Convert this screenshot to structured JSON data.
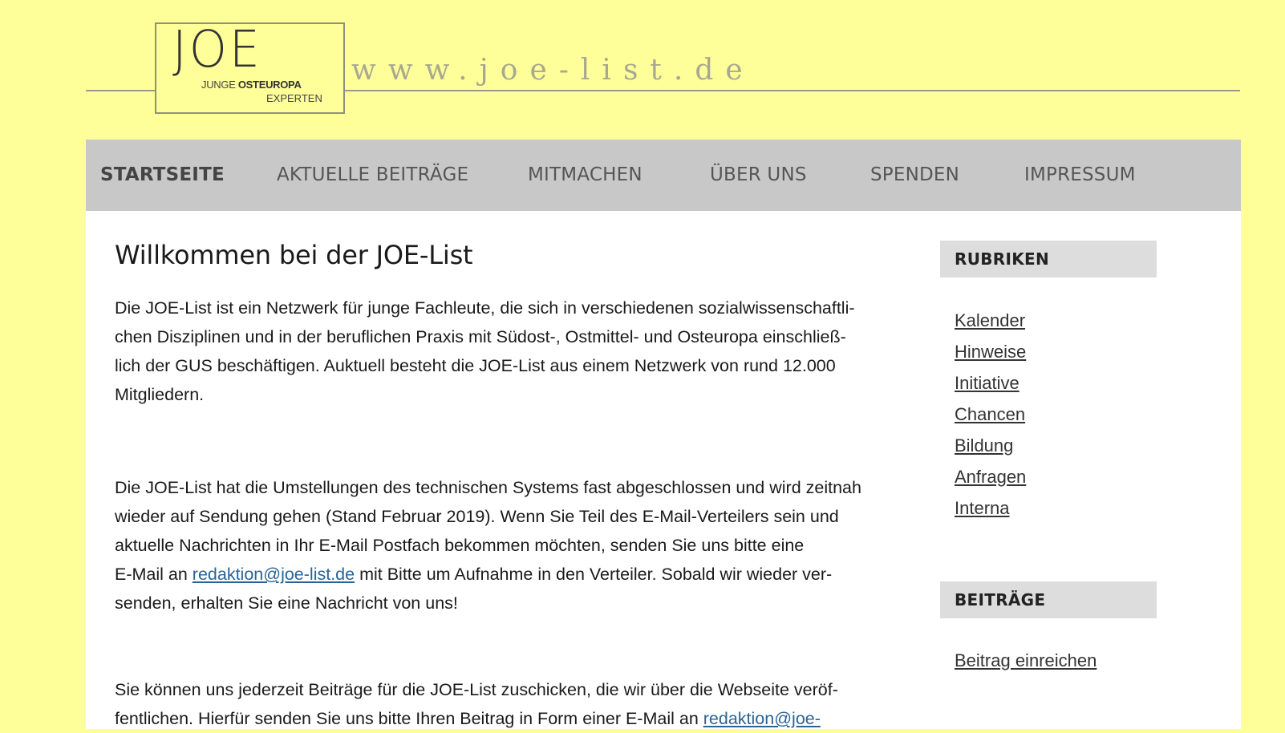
{
  "header": {
    "logo_main": "JOE",
    "logo_sub_light": "JUNGE ",
    "logo_sub_bold": "OSTEUROPA",
    "logo_sub2": "EXPERTEN",
    "site_url": "www.joe-list.de"
  },
  "nav": {
    "items": [
      {
        "label": "STARTSEITE",
        "active": true
      },
      {
        "label": "AKTUELLE BEITRÄGE"
      },
      {
        "label": "MITMACHEN"
      },
      {
        "label": "ÜBER UNS"
      },
      {
        "label": "SPENDEN"
      },
      {
        "label": "IMPRESSUM"
      }
    ]
  },
  "main": {
    "title": "Willkommen bei der JOE-List",
    "p1_lines": [
      "Die JOE-List ist ein Netzwerk für junge Fachleute, die sich in verschiedenen sozialwissenschaftli-",
      "chen Disziplinen und in der beruflichen Praxis mit Südost-, Ostmittel- und Osteuropa einschließ-",
      "lich der GUS beschäftigen. Auktuell besteht die JOE-List aus einem Netzwerk von rund 12.000",
      "Mitgliedern."
    ],
    "p2_lines": [
      "Die JOE-List hat die Umstellungen des technischen Systems fast abgeschlossen und wird zeitnah",
      "wieder auf Sendung gehen (Stand Februar 2019). Wenn Sie Teil des E-Mail-Verteilers sein und",
      "aktuelle Nachrichten in Ihr E-Mail Postfach bekommen möchten, senden Sie uns bitte eine"
    ],
    "p2_line4_pre": "E-Mail an ",
    "p2_link": "redaktion@joe-list.de",
    "p2_line4_post": " mit Bitte um Aufnahme in den Verteiler. Sobald wir wieder ver-",
    "p2_line5": "senden, erhalten Sie eine Nachricht von uns!",
    "p3_line1": "Sie können uns jederzeit Beiträge für die JOE-List zuschicken, die wir über die Webseite veröf-",
    "p3_line2_pre": "fentlichen. Hierfür senden Sie uns bitte Ihren Beitrag in Form einer E-Mail an ",
    "p3_link": "redaktion@joe-"
  },
  "sidebar": {
    "rubriken_title": "RUBRIKEN",
    "rubriken": [
      "Kalender",
      "Hinweise",
      "Initiative",
      "Chancen",
      "Bildung",
      "Anfragen",
      "Interna"
    ],
    "beitraege_title": "BEITRÄGE",
    "beitrag_link": "Beitrag einreichen"
  }
}
